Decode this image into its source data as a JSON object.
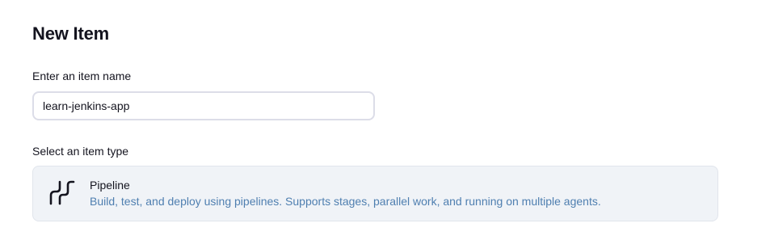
{
  "page": {
    "title": "New Item"
  },
  "item_name": {
    "label": "Enter an item name",
    "value": "learn-jenkins-app"
  },
  "item_type": {
    "label": "Select an item type",
    "options": [
      {
        "icon": "pipeline-icon",
        "name": "Pipeline",
        "description": "Build, test, and deploy using pipelines. Supports stages, parallel work, and running on multiple agents."
      }
    ]
  },
  "colors": {
    "description_text": "#4f7fb0",
    "card_background": "#f0f3f7",
    "input_border": "#dcdde8"
  }
}
